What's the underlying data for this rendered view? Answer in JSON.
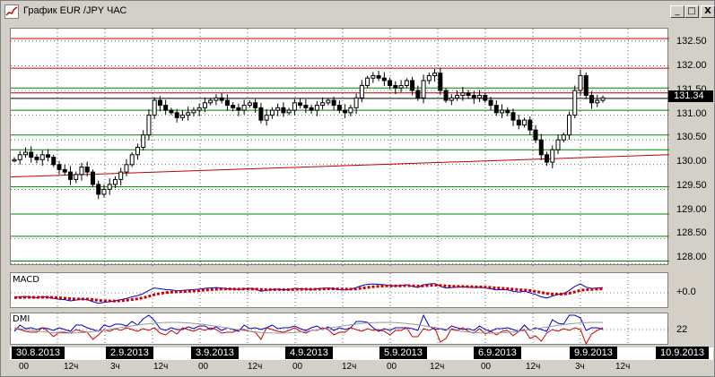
{
  "window": {
    "title": "График EUR /JPY  ЧАС",
    "minimize_glyph": "_",
    "maximize_glyph": "□",
    "close_glyph": "X"
  },
  "price_axis": {
    "ticks": [
      "132.50",
      "132.00",
      "131.50",
      "131.00",
      "130.50",
      "130.00",
      "129.50",
      "129.00",
      "128.50",
      "128.00"
    ],
    "current_price": "131.34"
  },
  "indicators": {
    "macd_label": "MACD",
    "macd_zero": "+0.0",
    "dmi_label": "DMI",
    "dmi_value": "22"
  },
  "time_axis": {
    "dates": [
      "30.8.2013",
      "2.9.2013",
      "3.9.2013",
      "4.9.2013",
      "5.9.2013",
      "6.9.2013",
      "9.9.2013",
      "10.9.2013"
    ],
    "hours": [
      "0",
      "12",
      "3",
      "12",
      "0",
      "12",
      "0",
      "12",
      "0",
      "12",
      "0",
      "12",
      "3",
      "12"
    ],
    "hour_suffix": "ч"
  },
  "colors": {
    "resistance_line": "#c00000",
    "support_line": "#008000",
    "candle": "#000000",
    "macd_signal": "#cc0000",
    "macd_line": "#0000cc"
  },
  "chart_data": {
    "type": "candlestick",
    "symbol": "EUR/JPY",
    "timeframe": "ЧАС",
    "ylim": [
      127.95,
      132.75
    ],
    "horizontal_levels": {
      "red": [
        132.55,
        131.95,
        131.45
      ],
      "green": [
        131.55,
        131.1,
        130.6,
        130.3,
        129.55,
        129.0,
        128.55,
        128.05
      ]
    },
    "trend_line": {
      "from": 129.75,
      "to": 130.2
    },
    "close_path": [
      130.1,
      130.2,
      130.25,
      130.15,
      130.1,
      130.2,
      130.15,
      130.0,
      129.9,
      129.85,
      129.7,
      129.8,
      129.95,
      129.85,
      129.6,
      129.4,
      129.5,
      129.6,
      129.7,
      129.85,
      130.0,
      130.2,
      130.35,
      130.6,
      131.0,
      131.3,
      131.2,
      131.1,
      131.05,
      130.95,
      131.0,
      131.05,
      131.1,
      131.15,
      131.25,
      131.3,
      131.35,
      131.3,
      131.2,
      131.15,
      131.1,
      131.2,
      131.25,
      131.15,
      130.9,
      131.0,
      131.1,
      131.15,
      131.05,
      131.1,
      131.25,
      131.2,
      131.15,
      131.1,
      131.2,
      131.25,
      131.3,
      131.2,
      131.1,
      131.05,
      131.15,
      131.35,
      131.6,
      131.75,
      131.8,
      131.75,
      131.7,
      131.6,
      131.55,
      131.6,
      131.7,
      131.5,
      131.35,
      131.7,
      131.8,
      131.85,
      131.5,
      131.3,
      131.35,
      131.4,
      131.45,
      131.4,
      131.35,
      131.4,
      131.3,
      131.2,
      131.05,
      131.1,
      131.05,
      130.9,
      130.8,
      130.9,
      130.7,
      130.5,
      130.2,
      130.05,
      130.3,
      130.5,
      130.6,
      131.0,
      131.5,
      131.8,
      131.4,
      131.25,
      131.3,
      131.35
    ]
  }
}
